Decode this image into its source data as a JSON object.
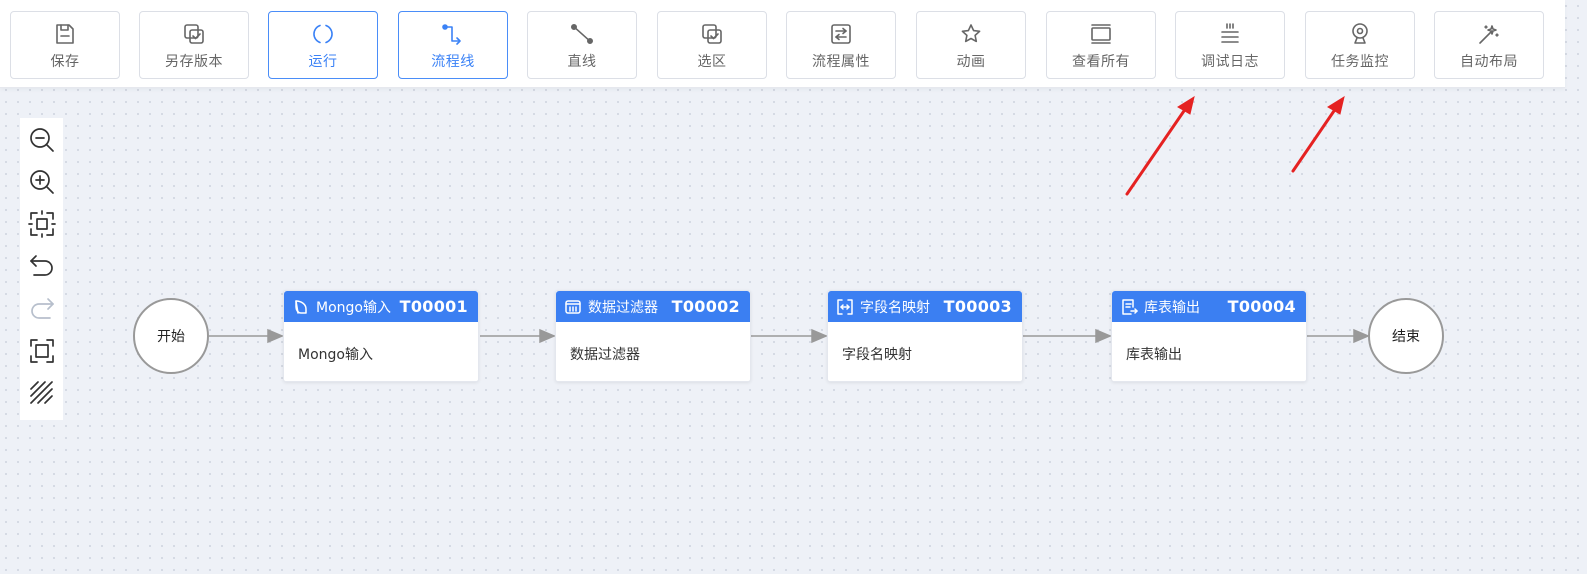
{
  "toolbar": {
    "buttons": [
      {
        "label": "保存",
        "icon": "save-icon"
      },
      {
        "label": "另存版本",
        "icon": "save-version-icon"
      },
      {
        "label": "运行",
        "icon": "run-icon"
      },
      {
        "label": "流程线",
        "icon": "flow-line-icon"
      },
      {
        "label": "直线",
        "icon": "straight-line-icon"
      },
      {
        "label": "选区",
        "icon": "selection-icon"
      },
      {
        "label": "流程属性",
        "icon": "flow-properties-icon"
      },
      {
        "label": "动画",
        "icon": "animation-icon"
      },
      {
        "label": "查看所有",
        "icon": "view-all-icon"
      },
      {
        "label": "调试日志",
        "icon": "debug-log-icon"
      },
      {
        "label": "任务监控",
        "icon": "task-monitor-icon"
      },
      {
        "label": "自动布局",
        "icon": "auto-layout-icon"
      }
    ]
  },
  "side_tools": [
    "zoom-out-icon",
    "zoom-in-icon",
    "fit-view-icon",
    "undo-icon",
    "redo-icon",
    "fullscreen-icon",
    "grid-toggle-icon"
  ],
  "flow": {
    "start_label": "开始",
    "end_label": "结束",
    "nodes": [
      {
        "title": "Mongo输入",
        "id": "T00001",
        "body": "Mongo输入",
        "icon": "mongo-icon"
      },
      {
        "title": "数据过滤器",
        "id": "T00002",
        "body": "数据过滤器",
        "icon": "filter-icon"
      },
      {
        "title": "字段名映射",
        "id": "T00003",
        "body": "字段名映射",
        "icon": "field-mapping-icon"
      },
      {
        "title": "库表输出",
        "id": "T00004",
        "body": "库表输出",
        "icon": "table-output-icon"
      }
    ]
  },
  "colors": {
    "accent": "#3b7ff2",
    "annotation_arrow": "#e52222",
    "canvas_bg": "#eef1f7"
  }
}
